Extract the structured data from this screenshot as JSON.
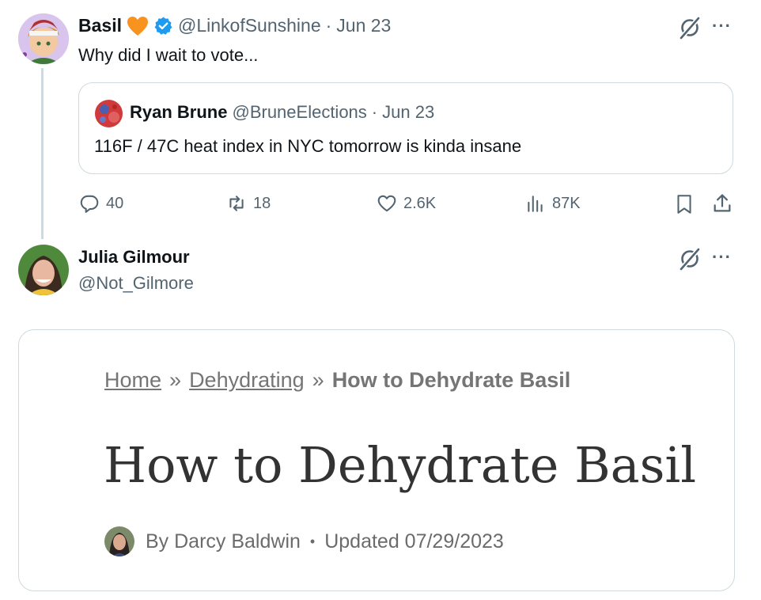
{
  "post1": {
    "display_name": "Basil",
    "handle": "@LinkofSunshine",
    "dot": "·",
    "date": "Jun 23",
    "text": "Why did I wait to vote...",
    "quote": {
      "display_name": "Ryan Brune",
      "handle": "@BruneElections",
      "dot": "·",
      "date": "Jun 23",
      "text": "116F / 47C heat index in NYC tomorrow is kinda insane"
    },
    "actions": {
      "replies": "40",
      "reposts": "18",
      "likes": "2.6K",
      "views": "87K"
    }
  },
  "post2": {
    "display_name": "Julia Gilmour",
    "handle": "@Not_Gilmore",
    "link_card": {
      "breadcrumb": {
        "home": "Home",
        "sep1": "»",
        "category": "Dehydrating",
        "sep2": "»",
        "current": "How to Dehydrate Basil"
      },
      "title": "How to Dehydrate Basil",
      "byline": {
        "author": "By Darcy Baldwin",
        "bullet": "•",
        "updated": "Updated 07/29/2023"
      }
    }
  },
  "more_label": "···",
  "colors": {
    "text_primary": "#0f1419",
    "text_muted": "#536471",
    "border": "#cfd9de",
    "verified_blue": "#1d9bf0",
    "heart_orange": "#f7931e"
  }
}
